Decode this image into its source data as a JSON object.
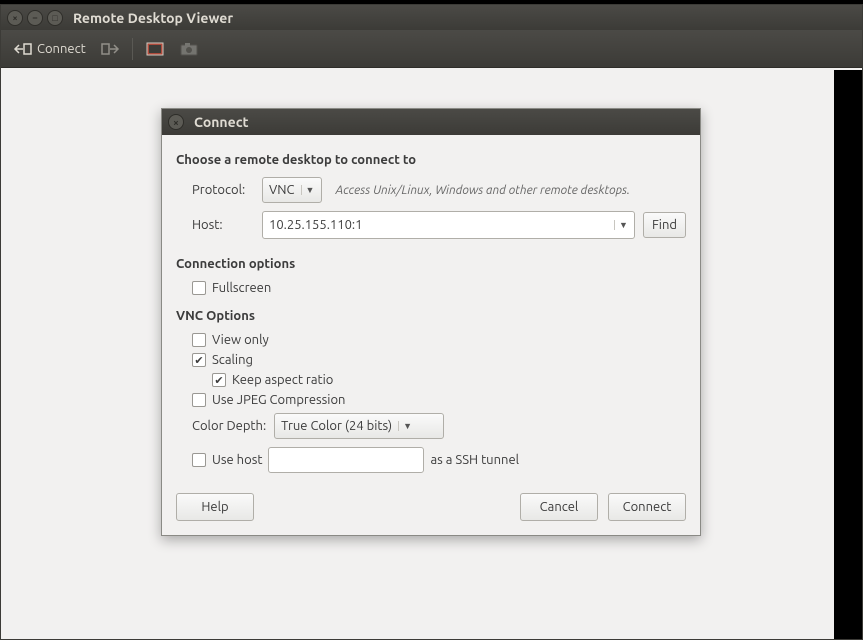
{
  "window": {
    "title": "Remote Desktop Viewer"
  },
  "toolbar": {
    "connect_label": "Connect"
  },
  "dialog": {
    "title": "Connect",
    "choose_heading": "Choose a remote desktop to connect to",
    "protocol_label": "Protocol:",
    "protocol_value": "VNC",
    "protocol_hint": "Access Unix/Linux, Windows and other remote desktops.",
    "host_label": "Host:",
    "host_value": "10.25.155.110:1",
    "find_label": "Find",
    "conn_options_heading": "Connection options",
    "fullscreen_label": "Fullscreen",
    "vnc_options_heading": "VNC Options",
    "viewonly_label": "View only",
    "scaling_label": "Scaling",
    "aspect_label": "Keep aspect ratio",
    "jpeg_label": "Use JPEG Compression",
    "colordepth_label": "Color Depth:",
    "colordepth_value": "True Color (24 bits)",
    "ssh_prefix": "Use host",
    "ssh_suffix": "as a SSH tunnel",
    "help_label": "Help",
    "cancel_label": "Cancel",
    "connect_label": "Connect"
  }
}
